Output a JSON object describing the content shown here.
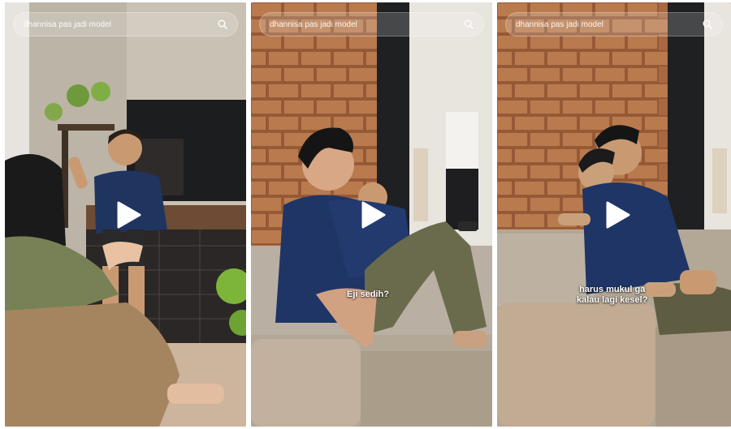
{
  "videos": [
    {
      "search_query": "dhannisa pas jadi model",
      "search_icon": "search-icon",
      "play_icon": "play-icon",
      "caption": ""
    },
    {
      "search_query": "dhannisa pas jadi model",
      "search_icon": "search-icon",
      "play_icon": "play-icon",
      "caption": "Eji sedih?"
    },
    {
      "search_query": "dhannisa pas jadi model",
      "search_icon": "search-icon",
      "play_icon": "play-icon",
      "caption_lines": [
        "harus mukul ga",
        "kalau lagi kesel?"
      ]
    }
  ]
}
